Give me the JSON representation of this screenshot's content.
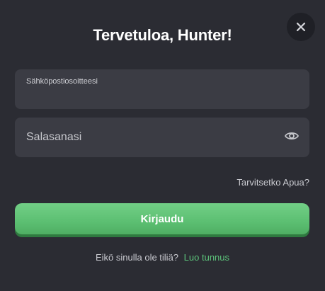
{
  "modal": {
    "title": "Tervetuloa, Hunter!",
    "close_icon": "close-icon"
  },
  "email_field": {
    "label": "Sähköpostiosoitteesi",
    "value": ""
  },
  "password_field": {
    "placeholder": "Salasanasi",
    "value": "",
    "toggle_icon": "eye-icon"
  },
  "help_link": "Tarvitsetko Apua?",
  "login_button": "Kirjaudu",
  "signup": {
    "prompt": "Eikö sinulla ole tiliä?",
    "link": "Luo tunnus"
  },
  "colors": {
    "background": "#2b2c33",
    "field_background": "#3b3c44",
    "accent_green": "#5cbf72",
    "link_green": "#5cc27a"
  }
}
